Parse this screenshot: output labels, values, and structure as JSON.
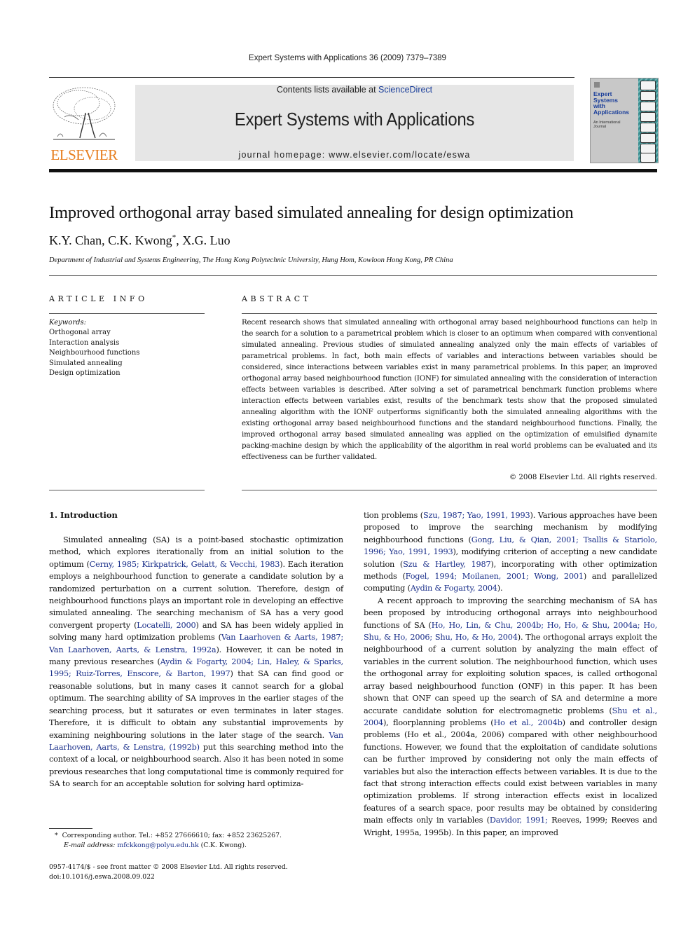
{
  "running_head": "Expert Systems with Applications 36 (2009) 7379–7389",
  "publisher": {
    "logo_icon": "elsevier-tree-icon",
    "name": "ELSEVIER",
    "brand_color": "#e77f20"
  },
  "banner": {
    "contents_prefix": "Contents lists available at ",
    "contents_link": "ScienceDirect",
    "journal_title": "Expert Systems with Applications",
    "homepage_label": "journal homepage: ",
    "homepage_url": "www.elsevier.com/locate/eswa"
  },
  "cover": {
    "title_lines": [
      "Expert",
      "Systems",
      "with",
      "Applications"
    ],
    "subtitle_lines": [
      "An International",
      "Journal"
    ]
  },
  "article": {
    "title": "Improved orthogonal array based simulated annealing for design optimization",
    "authors_before": "K.Y. Chan, C.K. Kwong",
    "author_mark": "*",
    "authors_after": ", X.G. Luo",
    "affiliation": "Department of Industrial and Systems Engineering, The Hong Kong Polytechnic University, Hung Hom, Kowloon Hong Kong, PR China"
  },
  "article_info": {
    "heading": "ARTICLE INFO",
    "keywords_label": "Keywords:",
    "keywords": [
      "Orthogonal array",
      "Interaction analysis",
      "Neighbourhood functions",
      "Simulated annealing",
      "Design optimization"
    ]
  },
  "abstract": {
    "heading": "ABSTRACT",
    "text": "Recent research shows that simulated annealing with orthogonal array based neighbourhood functions can help in the search for a solution to a parametrical problem which is closer to an optimum when compared with conventional simulated annealing. Previous studies of simulated annealing analyzed only the main effects of variables of parametrical problems. In fact, both main effects of variables and interactions between variables should be considered, since interactions between variables exist in many parametrical problems. In this paper, an improved orthogonal array based neighbourhood function (IONF) for simulated annealing with the consideration of interaction effects between variables is described. After solving a set of parametrical benchmark function problems where interaction effects between variables exist, results of the benchmark tests show that the proposed simulated annealing algorithm with the IONF outperforms significantly both the simulated annealing algorithms with the existing orthogonal array based neighbourhood functions and the standard neighbourhood functions. Finally, the improved orthogonal array based simulated annealing was applied on the optimization of emulsified dynamite packing-machine design by which the applicability of the algorithm in real world problems can be evaluated and its effectiveness can be further validated.",
    "copyright": "© 2008 Elsevier Ltd. All rights reserved."
  },
  "intro": {
    "heading": "1. Introduction",
    "left_p1": [
      {
        "t": "Simulated annealing (SA) is a point-based stochastic optimization method, which explores iterationally from an initial solution to the optimum ("
      },
      {
        "t": "Cerny, 1985; Kirkpatrick, Gelatt, & Vecchi, 1983",
        "ref": true
      },
      {
        "t": "). Each iteration employs a neighbourhood function to generate a candidate solution by a randomized perturbation on a current solution. Therefore, design of neighbourhood functions plays an important role in developing an effective simulated annealing. The searching mechanism of SA has a very good convergent property ("
      },
      {
        "t": "Locatelli, 2000",
        "ref": true
      },
      {
        "t": ") and SA has been widely applied in solving many hard optimization problems ("
      },
      {
        "t": "Van Laarhoven & Aarts, 1987; Van Laarhoven, Aarts, & Lenstra, 1992a",
        "ref": true
      },
      {
        "t": "). However, it can be noted in many previous researches ("
      },
      {
        "t": "Aydin & Fogarty, 2004; Lin, Haley, & Sparks, 1995; Ruiz-Torres, Enscore, & Barton, 1997",
        "ref": true
      },
      {
        "t": ") that SA can find good or reasonable solutions, but in many cases it cannot search for a global optimum. The searching ability of SA improves in the earlier stages of the searching process, but it saturates or even terminates in later stages. Therefore, it is difficult to obtain any substantial improvements by examining neighbouring solutions in the later stage of the search. "
      },
      {
        "t": "Van Laarhoven, Aarts, & Lenstra, (1992b)",
        "ref": true
      },
      {
        "t": " put this searching method into the context of a local, or neighbourhood search. Also it has been noted in some previous researches that long computational time is commonly required for SA to search for an acceptable solution for solving hard optimiza-"
      }
    ],
    "right_p1": [
      {
        "t": "tion problems ("
      },
      {
        "t": "Szu, 1987; Yao, 1991, 1993",
        "ref": true
      },
      {
        "t": "). Various approaches have been proposed to improve the searching mechanism by modifying neighbourhood functions ("
      },
      {
        "t": "Gong, Liu, & Qian, 2001; Tsallis & Stariolo, 1996; Yao, 1991, 1993",
        "ref": true
      },
      {
        "t": "), modifying criterion of accepting a new candidate solution ("
      },
      {
        "t": "Szu & Hartley, 1987",
        "ref": true
      },
      {
        "t": "), incorporating with other optimization methods ("
      },
      {
        "t": "Fogel, 1994; Moilanen, 2001; Wong, 2001",
        "ref": true
      },
      {
        "t": ") and parallelized computing ("
      },
      {
        "t": "Aydin & Fogarty, 2004",
        "ref": true
      },
      {
        "t": ")."
      }
    ],
    "right_p2": [
      {
        "t": "A recent approach to improving the searching mechanism of SA has been proposed by introducing orthogonal arrays into neighbourhood functions of SA ("
      },
      {
        "t": "Ho, Ho, Lin, & Chu, 2004b; Ho, Ho, & Shu, 2004a; Ho, Shu, & Ho, 2006; Shu, Ho, & Ho, 2004",
        "ref": true
      },
      {
        "t": "). The orthogonal arrays exploit the neighbourhood of a current solution by analyzing the main effect of variables in the current solution. The neighbourhood function, which uses the orthogonal array for exploiting solution spaces, is called orthogonal array based neighbourhood function (ONF) in this paper. It has been shown that ONF can speed up the search of SA and determine a more accurate candidate solution for electromagnetic problems ("
      },
      {
        "t": "Shu et al., 2004",
        "ref": true
      },
      {
        "t": "), floorplanning problems ("
      },
      {
        "t": "Ho et al., 2004b",
        "ref": true
      },
      {
        "t": ") and controller design problems (Ho et al., 2004a, 2006) compared with other neighbourhood functions. However, we found that the exploitation of candidate solutions can be further improved by considering not only the main effects of variables but also the interaction effects between variables. It is due to the fact that strong interaction effects could exist between variables in many optimization problems. If strong interaction effects exist in localized features of a search space, poor results may be obtained by considering main effects only in variables ("
      },
      {
        "t": "Davidor, 1991;",
        "ref": true
      },
      {
        "t": " Reeves, 1999; Reeves and Wright, 1995a, 1995b). In this paper, an improved"
      }
    ]
  },
  "footnote": {
    "mark": "*",
    "line1": "Corresponding author. Tel.: +852 27666610; fax: +852 23625267.",
    "email_label": "E-mail address:",
    "email": "mfckkong@polyu.edu.hk",
    "email_owner": " (C.K. Kwong)."
  },
  "issn": {
    "line1": "0957-4174/$ - see front matter © 2008 Elsevier Ltd. All rights reserved.",
    "doi": "doi:10.1016/j.eswa.2008.09.022"
  },
  "colors": {
    "link": "#1a2f8a",
    "banner_bg": "#e6e6e6"
  }
}
